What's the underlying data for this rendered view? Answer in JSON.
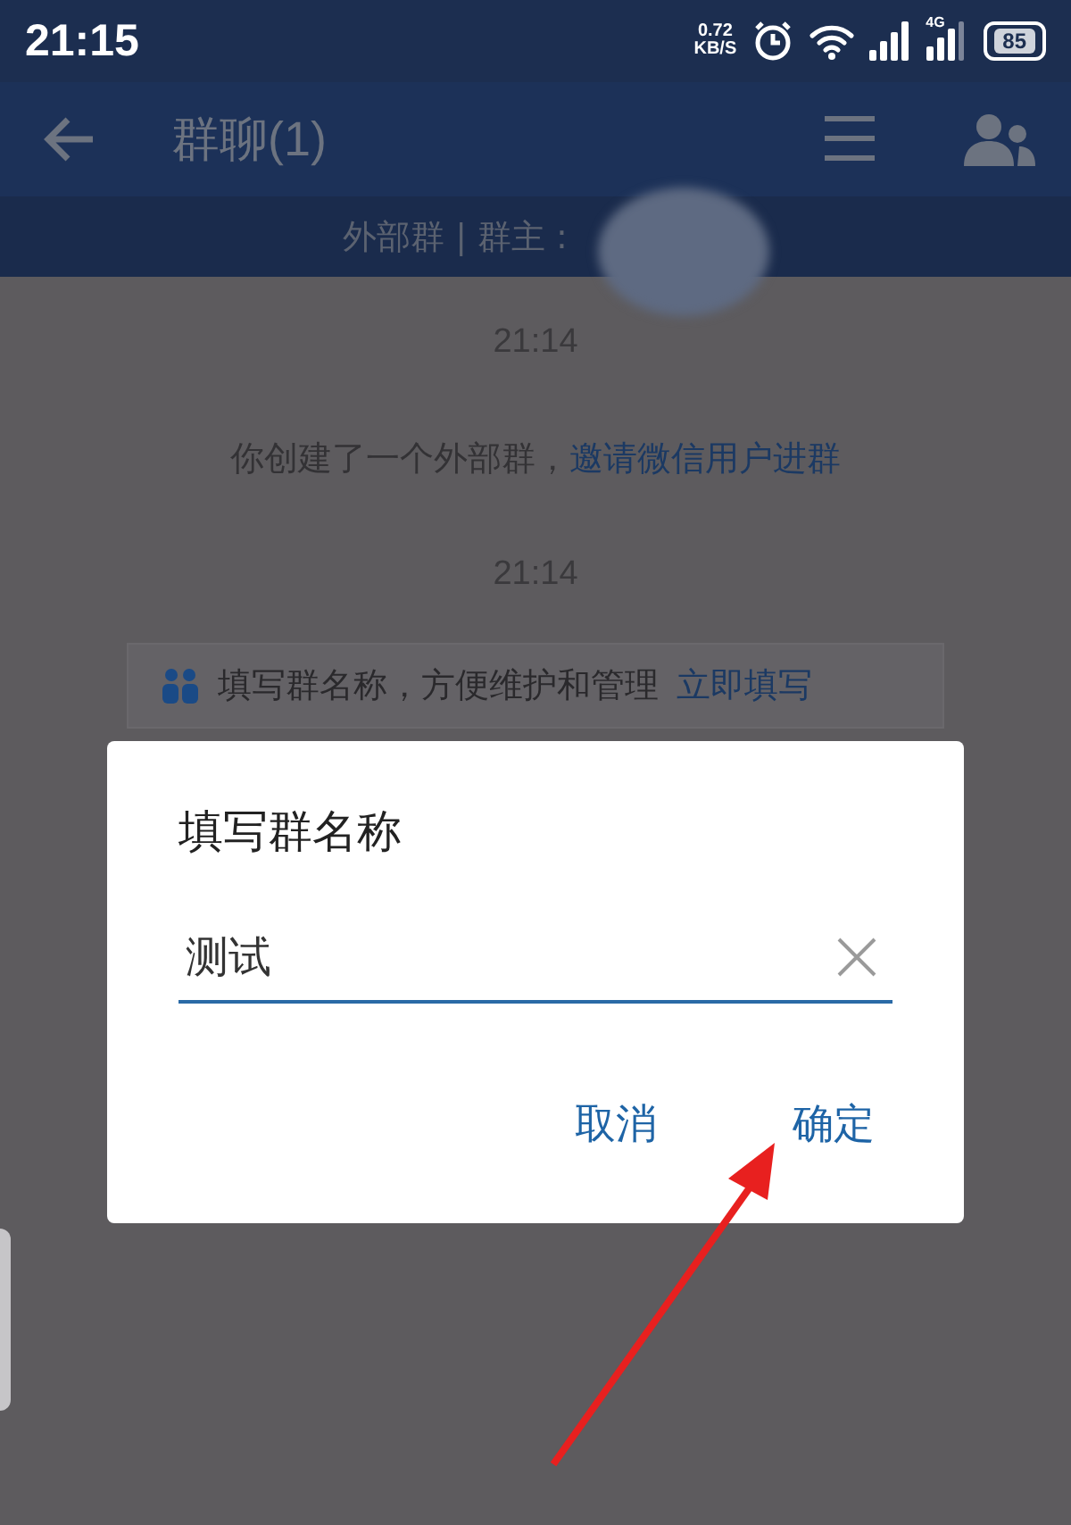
{
  "status_bar": {
    "time": "21:15",
    "net_speed": [
      "0.72",
      "KB/S"
    ],
    "network_type": "4G",
    "battery": "85"
  },
  "header": {
    "title": "群聊(1)"
  },
  "group_info": {
    "label": "外部群 | 群主 :"
  },
  "messages": [
    {
      "kind": "time",
      "text": "21:14"
    },
    {
      "kind": "system",
      "text": "你创建了一个外部群，",
      "link": "邀请微信用户进群"
    },
    {
      "kind": "time",
      "text": "21:14"
    },
    {
      "kind": "notice",
      "text": "填写群名称，方便维护和管理",
      "link": "立即填写"
    }
  ],
  "dialog": {
    "title": "填写群名称",
    "input": {
      "value": "测试"
    },
    "buttons": [
      "取消",
      "确定"
    ]
  }
}
